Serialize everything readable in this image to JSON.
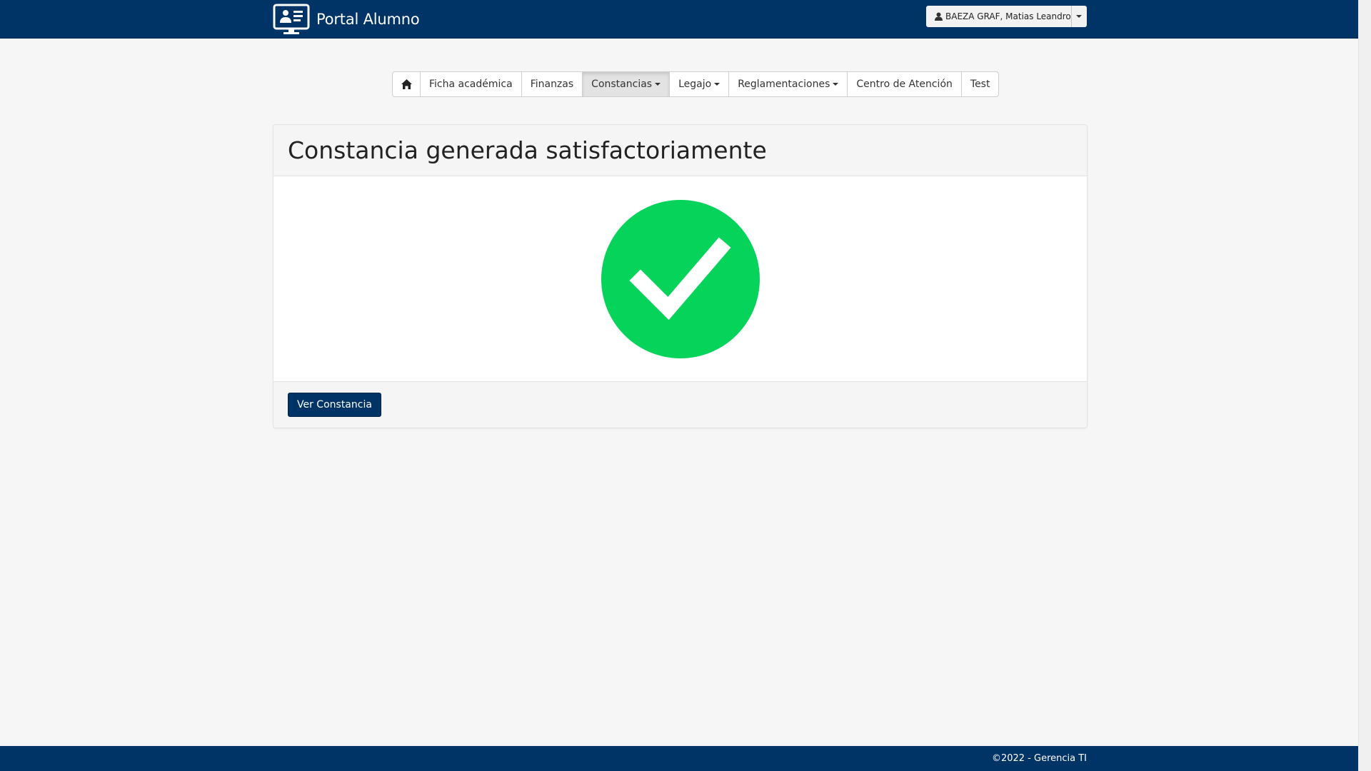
{
  "header": {
    "brand_title": "Portal Alumno",
    "user_name": "BAEZA GRAF, Matias Leandro"
  },
  "nav": {
    "items": [
      {
        "label": "Ficha académica"
      },
      {
        "label": "Finanzas"
      },
      {
        "label": "Constancias"
      },
      {
        "label": "Legajo"
      },
      {
        "label": "Reglamentaciones"
      },
      {
        "label": "Centro de Atención"
      },
      {
        "label": "Test"
      }
    ],
    "active": "Constancias"
  },
  "panel": {
    "title": "Constancia generada satisfactoriamente",
    "button_label": "Ver Constancia"
  },
  "footer": {
    "text": "©2022 - Gerencia TI"
  },
  "colors": {
    "brand": "#003366",
    "success": "#06d45a"
  },
  "icons": {
    "brand": "monitor-user-card-icon",
    "user": "user-icon",
    "home": "home-icon",
    "status": "check-circle-icon"
  }
}
